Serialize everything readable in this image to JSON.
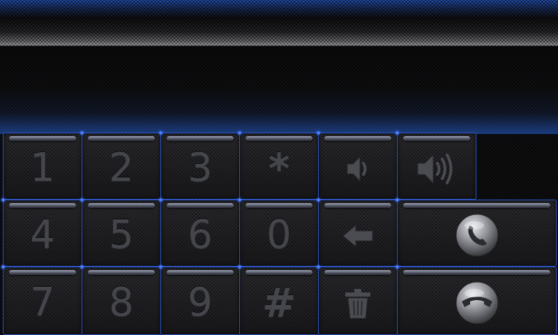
{
  "display": {
    "number": ""
  },
  "keys": {
    "one": "1",
    "two": "2",
    "three": "3",
    "star": "*",
    "four": "4",
    "five": "5",
    "six": "6",
    "zero": "0",
    "seven": "7",
    "eight": "8",
    "nine": "9",
    "hash": "#"
  },
  "icons": {
    "volume_down": "volume-down-icon",
    "volume_up": "volume-up-icon",
    "backspace": "backspace-arrow-icon",
    "delete": "trash-icon",
    "call": "phone-call-icon",
    "end_call": "phone-hangup-icon"
  },
  "colors": {
    "accent_blue": "#2b56c8",
    "glow_blue": "#4a7cff",
    "key_glyph": "#44464b",
    "key_background": "#232326"
  }
}
